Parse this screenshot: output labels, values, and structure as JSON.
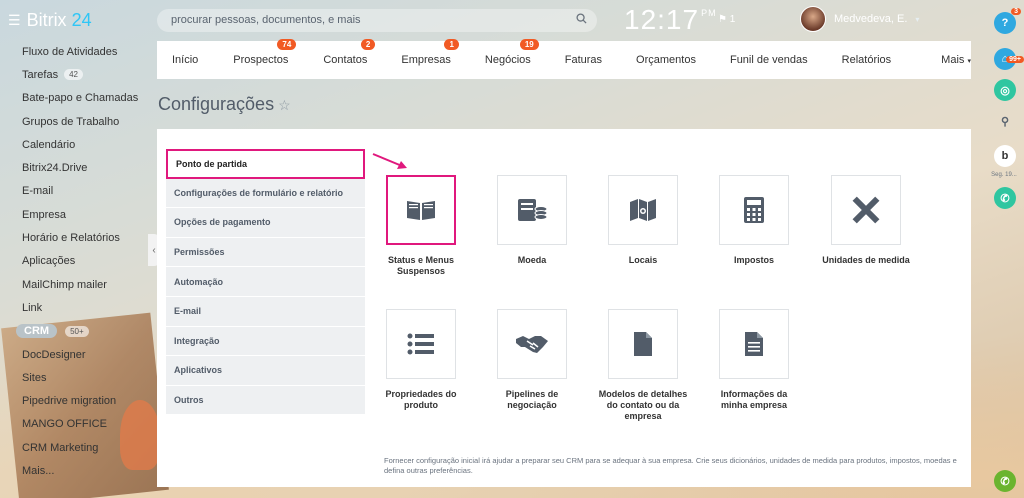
{
  "header": {
    "brand_prefix": "Bitrix",
    "brand_suffix": "24",
    "search_placeholder": "procurar pessoas, documentos, e mais",
    "clock": "12:17",
    "clock_suffix": "PM",
    "flag_count": "1",
    "user_name": "Medvedeva, E."
  },
  "leftmenu": {
    "items": [
      {
        "label": "Fluxo de Atividades"
      },
      {
        "label": "Tarefas",
        "count": "42"
      },
      {
        "label": "Bate-papo e Chamadas"
      },
      {
        "label": "Grupos de Trabalho"
      },
      {
        "label": "Calendário"
      },
      {
        "label": "Bitrix24.Drive"
      },
      {
        "label": "E-mail"
      },
      {
        "label": "Empresa"
      },
      {
        "label": "Horário e Relatórios"
      },
      {
        "label": "Aplicações"
      },
      {
        "label": "MailChimp mailer"
      },
      {
        "label": "Link"
      }
    ],
    "crm_label": "CRM",
    "crm_count": "50+",
    "items2": [
      {
        "label": "DocDesigner"
      },
      {
        "label": "Sites"
      },
      {
        "label": "Pipedrive migration"
      },
      {
        "label": "MANGO OFFICE"
      },
      {
        "label": "CRM Marketing"
      },
      {
        "label": "Mais..."
      }
    ]
  },
  "topbar": {
    "tabs": [
      {
        "label": "Início"
      },
      {
        "label": "Prospectos",
        "badge": "74"
      },
      {
        "label": "Contatos",
        "badge": "2"
      },
      {
        "label": "Empresas",
        "badge": "1"
      },
      {
        "label": "Negócios",
        "badge": "19"
      },
      {
        "label": "Faturas"
      },
      {
        "label": "Orçamentos"
      },
      {
        "label": "Funil de vendas"
      },
      {
        "label": "Relatórios"
      },
      {
        "label": "Mais"
      }
    ]
  },
  "page": {
    "title": "Configurações"
  },
  "settings_nav": {
    "items": [
      {
        "label": "Ponto de partida"
      },
      {
        "label": "Configurações de formulário e relatório"
      },
      {
        "label": "Opções de pagamento"
      },
      {
        "label": "Permissões"
      },
      {
        "label": "Automação"
      },
      {
        "label": "E-mail"
      },
      {
        "label": "Integração"
      },
      {
        "label": "Aplicativos"
      },
      {
        "label": "Outros"
      }
    ]
  },
  "tiles": [
    {
      "label": "Status e Menus Suspensos",
      "icon": "book-icon"
    },
    {
      "label": "Moeda",
      "icon": "coins-icon"
    },
    {
      "label": "Locais",
      "icon": "map-icon"
    },
    {
      "label": "Impostos",
      "icon": "calculator-icon"
    },
    {
      "label": "Unidades de medida",
      "icon": "ruler-pencil-icon"
    },
    {
      "label": "Propriedades do produto",
      "icon": "list-icon"
    },
    {
      "label": "Pipelines de negociação",
      "icon": "handshake-icon"
    },
    {
      "label": "Modelos de detalhes do contato ou da empresa",
      "icon": "document-icon"
    },
    {
      "label": "Informações da minha empresa",
      "icon": "document-lines-icon"
    }
  ],
  "footer_text": "Fornecer configuração inicial irá ajudar a preparar seu CRM para se adequar à sua empresa. Crie seus dicionários, unidades de medida para produtos, impostos, moedas e defina outras preferências.",
  "rightbar": {
    "help_badge": "3",
    "notify_badge": "99+",
    "user_short_label": "Seg. 19..."
  },
  "colors": {
    "accent": "#e0187d",
    "badge": "#f15a24",
    "brand": "#2fc6f6"
  }
}
